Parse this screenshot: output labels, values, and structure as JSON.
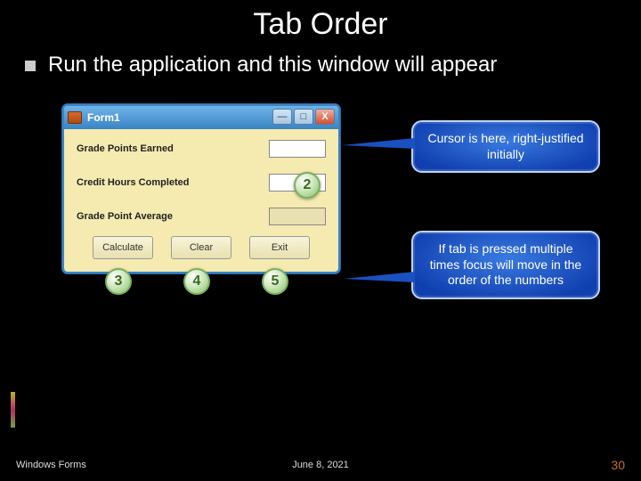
{
  "title": "Tab Order",
  "bullet": "Run the application and this window will appear",
  "window": {
    "title": "Form1",
    "labels": {
      "grade_points": "Grade Points Earned",
      "credit_hours": "Credit Hours Completed",
      "gpa": "Grade Point Average"
    },
    "buttons": {
      "calculate": "Calculate",
      "clear": "Clear",
      "exit": "Exit"
    }
  },
  "tab_numbers": {
    "n2": "2",
    "n3": "3",
    "n4": "4",
    "n5": "5"
  },
  "callouts": {
    "cursor": "Cursor is here, right-justified initially",
    "tab": "If tab is pressed multiple times focus will move in the order of the numbers"
  },
  "footer": {
    "left": "Windows Forms",
    "date": "June 8, 2021",
    "page": "30"
  }
}
